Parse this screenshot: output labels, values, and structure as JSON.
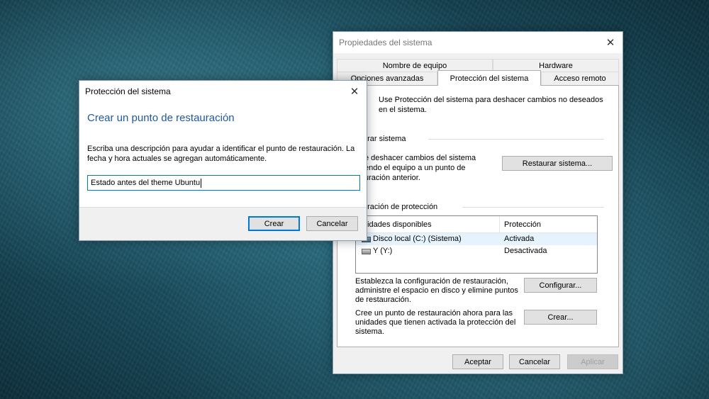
{
  "system_properties": {
    "title": "Propiedades del sistema",
    "tabs_top": [
      "Nombre de equipo",
      "Hardware"
    ],
    "tabs_bottom": [
      "Opciones avanzadas",
      "Protección del sistema",
      "Acceso remoto"
    ],
    "intro_line1": "Use Protección del sistema para deshacer cambios no deseados",
    "intro_line2": "en el sistema.",
    "restore_group": "urar sistema",
    "restore_desc": [
      "e deshacer cambios del sistema",
      "endo el equipo a un punto de",
      "uración anterior."
    ],
    "restore_button": "Restaurar sistema...",
    "protection_group": "uración de protección",
    "list_headers": [
      "nidades disponibles",
      "Protección"
    ],
    "drives": [
      {
        "name": "Disco local (C:) (Sistema)",
        "status": "Activada"
      },
      {
        "name": "Y (Y:)",
        "status": "Desactivada"
      }
    ],
    "configure_desc": [
      "Establezca la configuración de restauración,",
      "administre el espacio en disco y elimine puntos",
      "de restauración."
    ],
    "configure_button": "Configurar...",
    "create_desc": [
      "Cree un punto de restauración ahora para las",
      "unidades que tienen activada la protección del",
      "sistema."
    ],
    "create_button": "Crear...",
    "ok_button": "Aceptar",
    "cancel_button": "Cancelar",
    "apply_button": "Aplicar"
  },
  "dialog": {
    "title": "Protección del sistema",
    "heading": "Crear un punto de restauración",
    "desc_line1": "Escriba una descripción para ayudar a identificar el punto de restauración. La",
    "desc_line2": "fecha y hora actuales se agregan automáticamente.",
    "input_value": "Estado antes del theme Ubuntu",
    "create_button": "Crear",
    "cancel_button": "Cancelar"
  }
}
